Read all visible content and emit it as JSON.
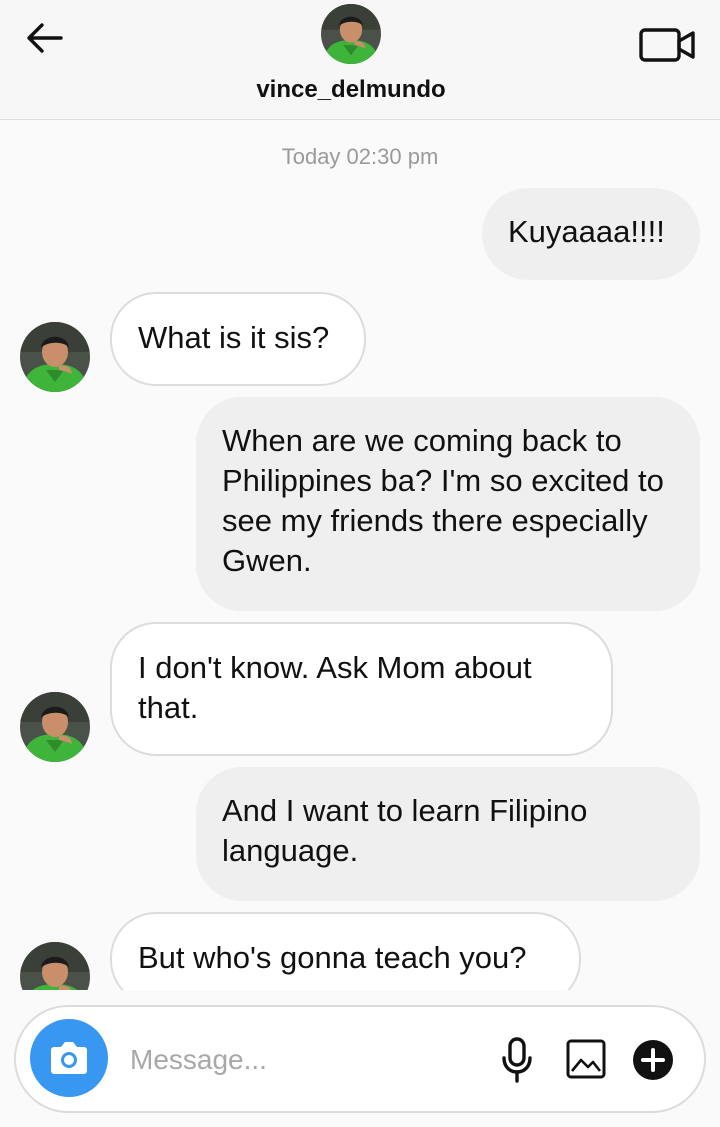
{
  "header": {
    "username": "vince_delmundo",
    "back_icon": "arrow-left-icon",
    "video_icon": "video-camera-icon"
  },
  "thread": {
    "timestamp": "Today 02:30 pm",
    "messages": [
      {
        "from": "me",
        "text": "Kuyaaaa!!!!"
      },
      {
        "from": "contact",
        "text": "What is it sis?"
      },
      {
        "from": "me",
        "text": "When are we coming back to Philippines ba? I'm so excited to see my friends there especially Gwen."
      },
      {
        "from": "contact",
        "text": "I don't know. Ask Mom about that."
      },
      {
        "from": "me",
        "text": "And I want to learn Filipino language."
      },
      {
        "from": "contact",
        "text": "But who's gonna teach you?"
      }
    ]
  },
  "composer": {
    "placeholder": "Message...",
    "value": "",
    "icons": [
      "camera-icon",
      "microphone-icon",
      "gallery-icon",
      "plus-icon"
    ]
  },
  "colors": {
    "accent": "#3897f0",
    "outgoing_bubble": "#efefef",
    "incoming_bubble": "#ffffff",
    "avatar_shirt": "#3fb43b"
  }
}
